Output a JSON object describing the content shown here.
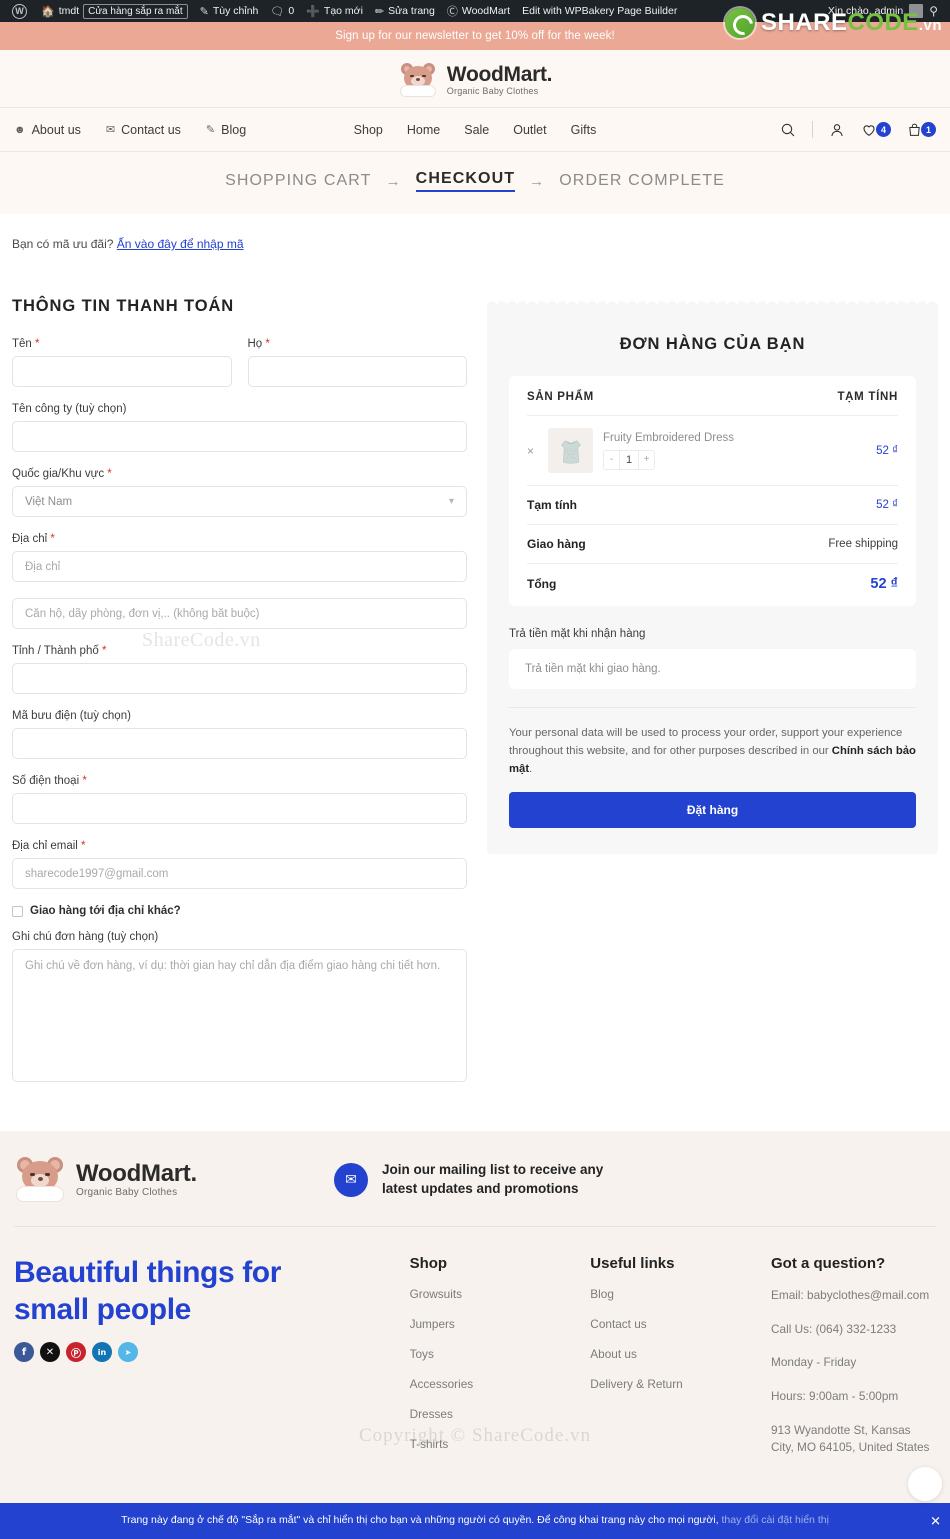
{
  "adminbar": {
    "site_name": "tmdt",
    "coming_soon_pill": "Cửa hàng sắp ra mắt",
    "customize": "Tùy chỉnh",
    "comments_count": "0",
    "new": "Tạo mới",
    "edit_page": "Sửa trang",
    "woodmart": "WoodMart",
    "wpbakery": "Edit with WPBakery Page Builder",
    "greeting": "Xin chào, admin"
  },
  "watermark": {
    "brand_a": "SHARE",
    "brand_b": "CODE",
    "brand_c": ".vn",
    "mid": "ShareCode.vn",
    "copy": "Copyright © ShareCode.vn"
  },
  "promo": {
    "text": "Sign up for our newsletter to get 10% off for the week!"
  },
  "brand": {
    "name": "WoodMart.",
    "tagline": "Organic Baby Clothes"
  },
  "nav": {
    "left": [
      {
        "label": "About us",
        "icon": "users-icon",
        "glyph": "⚇"
      },
      {
        "label": "Contact us",
        "icon": "envelope-icon",
        "glyph": "✉"
      },
      {
        "label": "Blog",
        "icon": "pencil-note-icon",
        "glyph": "✎"
      }
    ],
    "center": [
      {
        "label": "Shop"
      },
      {
        "label": "Home"
      },
      {
        "label": "Sale"
      },
      {
        "label": "Outlet"
      },
      {
        "label": "Gifts"
      }
    ],
    "wishlist_count": "4",
    "cart_count": "1"
  },
  "steps": {
    "cart": "SHOPPING CART",
    "arrow": "→",
    "checkout": "CHECKOUT",
    "complete": "ORDER COMPLETE"
  },
  "coupon": {
    "question": "Bạn có mã ưu đãi?",
    "link": "Ấn vào đây để nhập mã"
  },
  "billing": {
    "title": "THÔNG TIN THANH TOÁN",
    "first_name_label": "Tên",
    "first_name_value": "",
    "last_name_label": "Họ",
    "last_name_value": "",
    "company_label": "Tên công ty (tuỳ chọn)",
    "company_value": "",
    "country_label": "Quốc gia/Khu vực",
    "country_value": "Việt Nam",
    "address_label": "Địa chỉ",
    "address_placeholder": "Địa chỉ",
    "address2_placeholder": "Căn hộ, dãy phòng, đơn vị,.. (không bắt buộc)",
    "city_label": "Tỉnh / Thành phố",
    "city_value": "",
    "postcode_label": "Mã bưu điện (tuỳ chọn)",
    "postcode_value": "",
    "phone_label": "Số điện thoại",
    "phone_value": "",
    "email_label": "Địa chỉ email",
    "email_placeholder": "sharecode1997@gmail.com",
    "ship_different_label": "Giao hàng tới địa chỉ khác?",
    "notes_label": "Ghi chú đơn hàng (tuỳ chọn)",
    "notes_placeholder": "Ghi chú về đơn hàng, ví dụ: thời gian hay chỉ dẫn địa điểm giao hàng chi tiết hơn.",
    "required_mark": "*"
  },
  "order": {
    "title": "ĐƠN HÀNG CỦA BẠN",
    "col_product": "SẢN PHẨM",
    "col_subtotal": "TẠM TÍNH",
    "remove_glyph": "×",
    "item": {
      "name": "Fruity Embroidered Dress",
      "qty": "1",
      "qty_minus": "-",
      "qty_plus": "+",
      "line_total": "52 ₫"
    },
    "subtotal_label": "Tạm tính",
    "subtotal_value": "52 ₫",
    "shipping_label": "Giao hàng",
    "shipping_value": "Free shipping",
    "total_label": "Tổng",
    "total_value": "52 ₫",
    "payment_title": "Trả tiền mặt khi nhận hàng",
    "payment_desc": "Trả tiền mặt khi giao hàng.",
    "privacy_text": "Your personal data will be used to process your order, support your experience throughout this website, and for other purposes described in our ",
    "privacy_link": "Chính sách bảo mật",
    "privacy_end": ".",
    "place_order": "Đặt hàng"
  },
  "footer": {
    "mail_text_line1": "Join our mailing list to receive any",
    "mail_text_line2": "latest updates and promotions",
    "mail_icon": "envelope-icon",
    "slogan_line1": "Beautiful things for",
    "slogan_line2": "small people",
    "socials": [
      {
        "name": "facebook-icon",
        "glyph": "f",
        "color": "#3b5998"
      },
      {
        "name": "x-twitter-icon",
        "glyph": "✕",
        "color": "#111111"
      },
      {
        "name": "pinterest-icon",
        "glyph": "Ⓟ",
        "color": "#c8232c"
      },
      {
        "name": "linkedin-icon",
        "glyph": "in",
        "color": "#1274b3"
      },
      {
        "name": "telegram-icon",
        "glyph": "➤",
        "color": "#53b7e8"
      }
    ],
    "shop": {
      "title": "Shop",
      "links": [
        "Growsuits",
        "Jumpers",
        "Toys",
        "Accessories",
        "Dresses",
        "T-shirts"
      ]
    },
    "useful": {
      "title": "Useful links",
      "links": [
        "Blog",
        "Contact us",
        "About us",
        "Delivery & Return"
      ]
    },
    "question": {
      "title": "Got a question?",
      "lines": [
        "Email: babyclothes@mail.com",
        "Call Us: (064) 332-1233",
        "Monday - Friday",
        "Hours: 9:00am - 5:00pm",
        "913 Wyandotte St, Kansas City, MO 64105, United States"
      ]
    }
  },
  "bottom_bar": {
    "text": "Trang này đang ở chế độ \"Sắp ra mắt\" và chỉ hiển thị cho bạn và những người có quyền. Để công khai trang này cho mọi người,",
    "link": "thay đổi cài đặt hiển thị",
    "close": "✕"
  }
}
